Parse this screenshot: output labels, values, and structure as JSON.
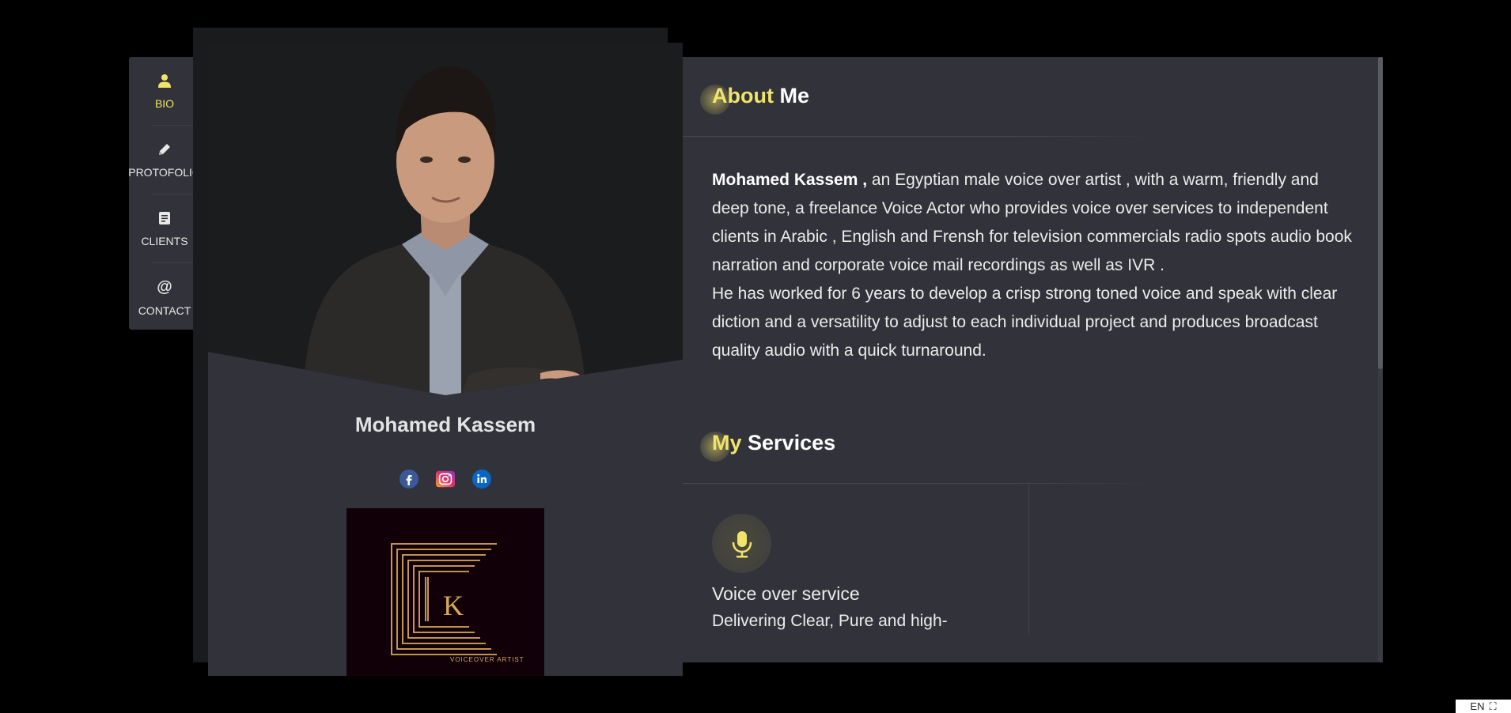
{
  "nav": {
    "items": [
      {
        "label": "BIO",
        "icon": "user-icon",
        "active": true
      },
      {
        "label": "PROTOFOLIO",
        "icon": "pencil-icon",
        "active": false
      },
      {
        "label": "CLIENTS",
        "icon": "document-icon",
        "active": false
      },
      {
        "label": "CONTACT",
        "icon": "at-icon",
        "active": false
      }
    ]
  },
  "profile": {
    "name": "Mohamed Kassem",
    "socials": [
      {
        "icon": "facebook-icon"
      },
      {
        "icon": "instagram-icon"
      },
      {
        "icon": "linkedin-icon"
      }
    ],
    "logo": {
      "letter": "K",
      "caption": "VOICEOVER ARTIST"
    }
  },
  "about": {
    "title_accent": "About",
    "title_rest": " Me",
    "name_bold": "Mohamed Kassem ,",
    "paragraph1": " an Egyptian male voice over artist , with a warm, friendly and deep tone, a freelance Voice Actor who provides voice over services to independent clients in Arabic , English and Frensh for television commercials radio spots audio book narration and corporate voice mail recordings as well as IVR .",
    "paragraph2": "He has worked for 6 years to develop a crisp strong toned voice and speak with clear diction and a versatility to adjust to each individual project and produces broadcast quality audio with a quick turnaround."
  },
  "services": {
    "title_accent": "My",
    "title_rest": " Services",
    "items": [
      {
        "icon": "microphone-icon",
        "title": "Voice over service",
        "desc": "Delivering Clear, Pure and high-"
      }
    ]
  },
  "language": {
    "label": "EN"
  },
  "colors": {
    "accent": "#f1e46b",
    "panel": "#31323a",
    "background": "#000000"
  }
}
